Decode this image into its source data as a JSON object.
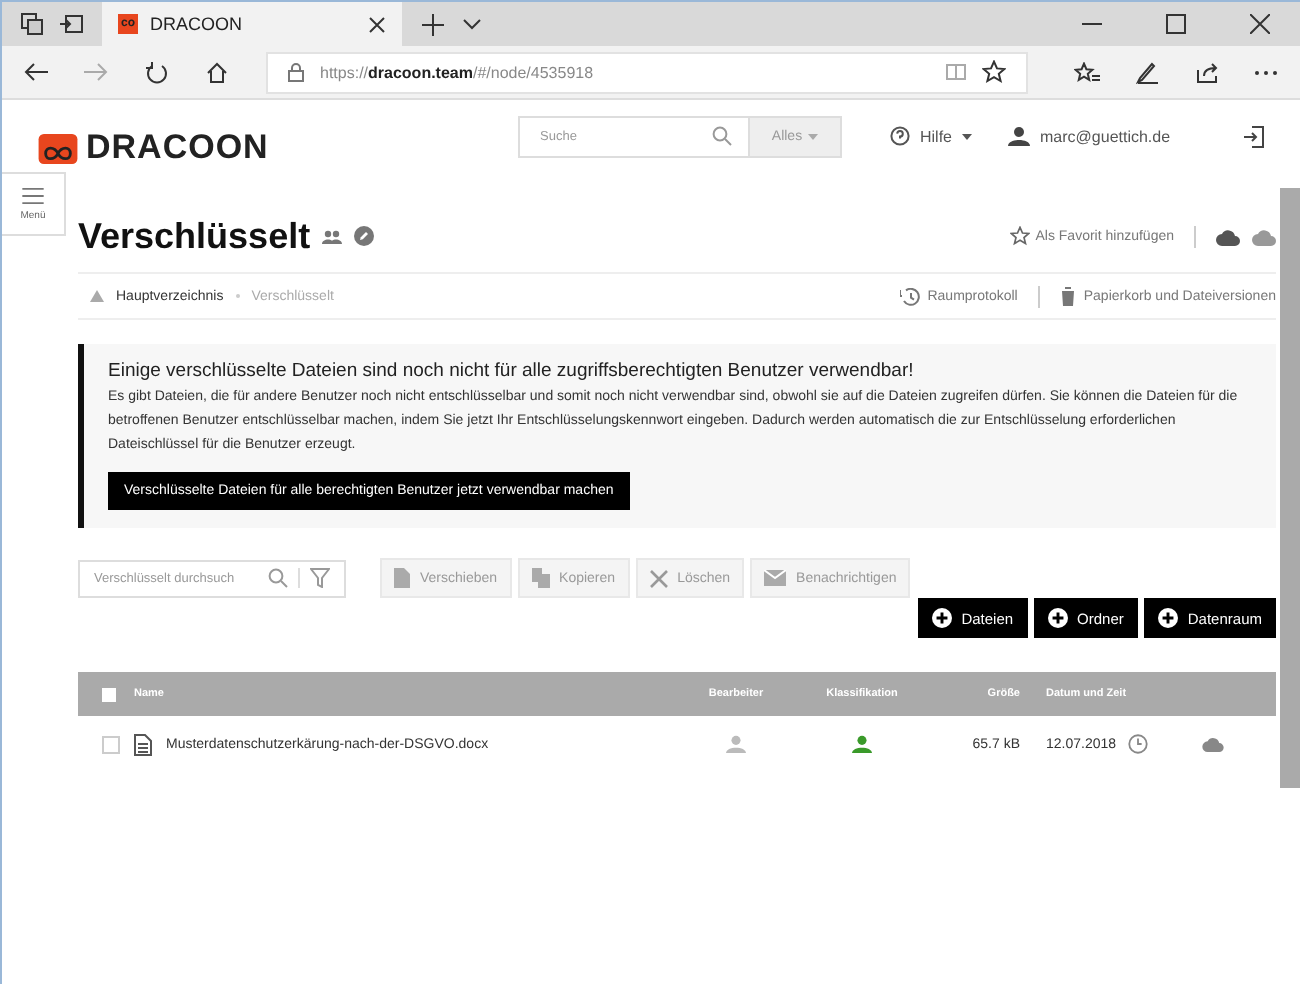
{
  "browser": {
    "tab_title": "DRACOON",
    "tab_logo": "co",
    "url": "https://**dracoon.team**/#/node/4535918"
  },
  "header": {
    "logo": "DRACOON",
    "search": {
      "placeholder": "Suche"
    },
    "scope": "Alles",
    "help": "Hilfe",
    "user": "marc@guettich.de"
  },
  "menu": {
    "label": "Menü"
  },
  "page": {
    "title": "Verschlüsselt",
    "favorite": "Als Favorit hinzufügen"
  },
  "breadcrumbs": [
    {
      "label": "Hauptverzeichnis",
      "current": false
    },
    {
      "label": "Verschlüsselt",
      "current": true
    }
  ],
  "links": [
    "Raumprotokoll",
    "Papierkorb und Dateiversionen"
  ],
  "alert": {
    "title": "Einige verschlüsselte Dateien sind noch nicht für alle zugriffsberechtigten Benutzer verwendbar!",
    "text": "Es gibt Dateien, die für andere Benutzer noch nicht entschlüsselbar und somit noch nicht verwendbar sind, obwohl sie auf die Dateien zugreifen dürfen. Sie können die Dateien für die betroffenen Benutzer entschlüsselbar machen, indem Sie jetzt Ihr Entschlüsselungskennwort eingeben. Dadurch werden automatisch die zur Entschlüsselung erforderlichen Dateischlüssel für die Benutzer erzeugt.",
    "button": "Verschlüsselte Dateien für alle berechtigten Benutzer jetzt verwendbar machen"
  },
  "filter": {
    "placeholder": "Verschlüsselt durchsuch"
  },
  "actions": [
    {
      "label": "Verschieben",
      "kind": "move",
      "disabled": true
    },
    {
      "label": "Kopieren",
      "kind": "copy",
      "disabled": true
    },
    {
      "label": "Löschen",
      "kind": "delete",
      "disabled": true
    },
    {
      "label": "Benachrichtigen",
      "kind": "mail",
      "disabled": true
    }
  ],
  "create_buttons": [
    "Dateien",
    "Ordner",
    "Datenraum"
  ],
  "table": {
    "all_selected": false,
    "columns": [
      "Name",
      "Bearbeiter",
      "Klassifikation",
      "Größe",
      "Datum und Zeit"
    ],
    "rows": [
      {
        "name": "Musterdatenschutzerkärung-nach-der-DSGVO.docx",
        "selected": false,
        "classified": true,
        "size": "65.7 kB",
        "date": "12.07.2018"
      }
    ]
  }
}
